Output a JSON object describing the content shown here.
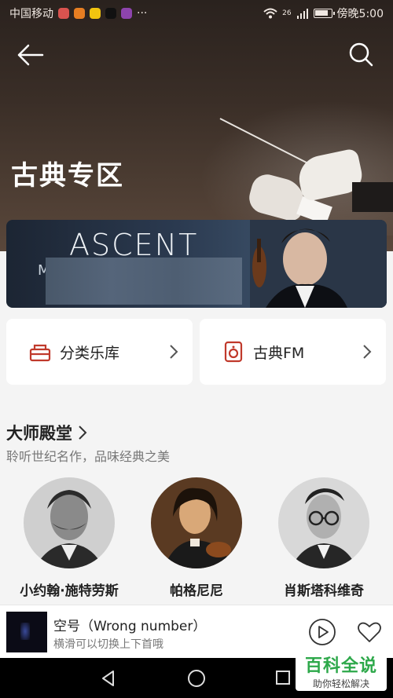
{
  "status_bar": {
    "carrier": "中国移动",
    "more_indicator": "···",
    "network_badge": "26",
    "time": "傍晚5:00"
  },
  "header": {
    "title": "古典专区"
  },
  "banner": {
    "title": "ASCENT",
    "subtitle_fragment": "M"
  },
  "quick_links": [
    {
      "label": "分类乐库",
      "icon": "library-icon"
    },
    {
      "label": "古典FM",
      "icon": "speaker-icon"
    }
  ],
  "masters": {
    "title": "大师殿堂",
    "subtitle": "聆听世纪名作，品味经典之美",
    "items": [
      {
        "name": "小约翰·施特劳斯"
      },
      {
        "name": "帕格尼尼"
      },
      {
        "name": "肖斯塔科维奇"
      }
    ]
  },
  "player": {
    "title": "空号（Wrong number）",
    "hint": "横滑可以切换上下首哦"
  },
  "watermark": {
    "main": "百科全说",
    "sub": "助你轻松解决"
  },
  "colors": {
    "accent_red": "#c0392b",
    "watermark_green": "#2da84a"
  }
}
